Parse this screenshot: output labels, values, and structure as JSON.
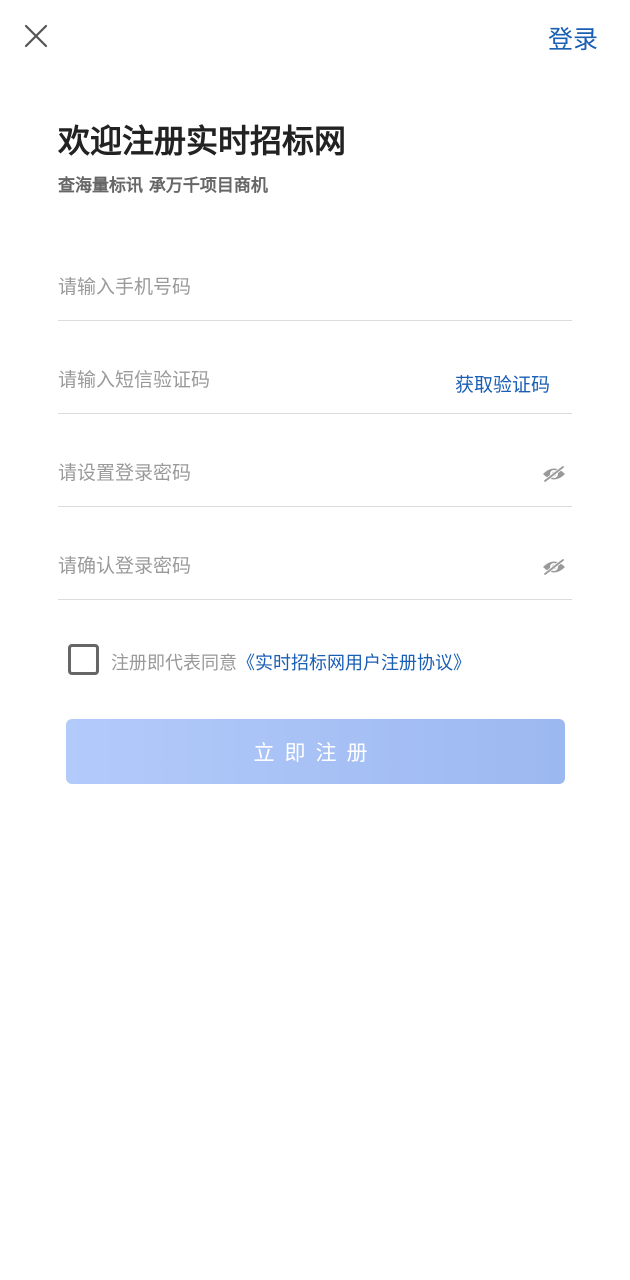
{
  "header": {
    "close_icon": "close-icon",
    "login_label": "登录"
  },
  "intro": {
    "title": "欢迎注册实时招标网",
    "subtitle": "查海量标讯 承万千项目商机"
  },
  "form": {
    "phone_placeholder": "请输入手机号码",
    "sms_placeholder": "请输入短信验证码",
    "get_code_label": "获取验证码",
    "password_placeholder": "请设置登录密码",
    "confirm_placeholder": "请确认登录密码",
    "eye_icon": "eye-off-icon"
  },
  "agreement": {
    "prefix": "注册即代表同意",
    "link": "《实时招标网用户注册协议》",
    "checked": false
  },
  "submit": {
    "label": "立即注册"
  },
  "colors": {
    "accent": "#1a5fb4",
    "button_gradient_start": "#b3cbfb",
    "button_gradient_end": "#9cb8f0",
    "title": "#222222",
    "placeholder": "#9a9a9a"
  }
}
